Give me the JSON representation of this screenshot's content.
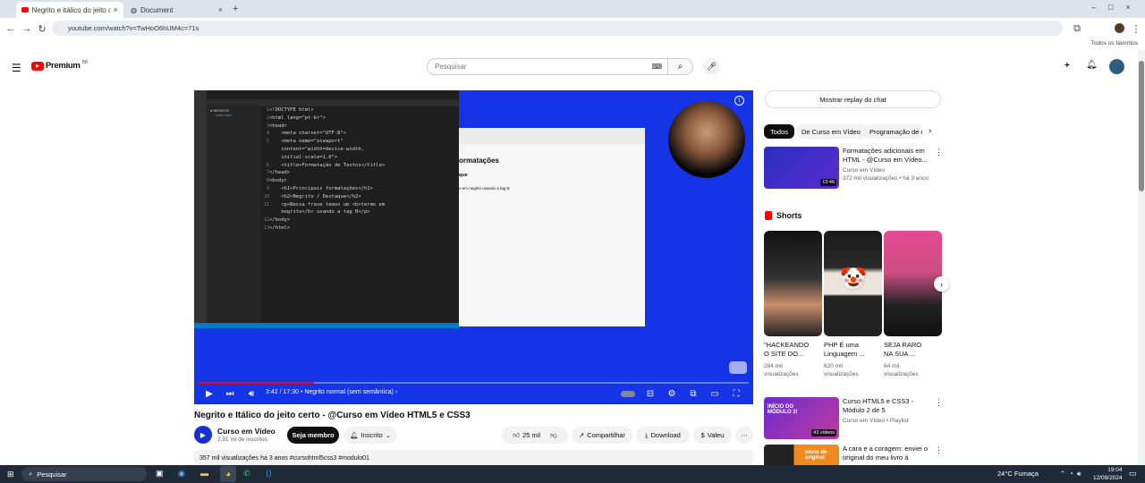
{
  "browser": {
    "tabs": [
      {
        "title": "Negrito e itálico do jeito certo",
        "active": true,
        "icon": "youtube-icon"
      },
      {
        "title": "Document",
        "active": false,
        "icon": "globe-icon"
      }
    ],
    "new_tab": "+",
    "url": "youtube.com/watch?v=TwHoO6hUM4c=71s",
    "bookmarks_label": "Todos os favoritos"
  },
  "youtube": {
    "logo_text": "Premium",
    "logo_region": "BR",
    "search_placeholder": "Pesquisar",
    "create_label": "+",
    "video": {
      "title": "Negrito e Itálico do jeito certo - @Curso em Vídeo HTML5 e CSS3",
      "time": "3:42 / 17:30",
      "chapter": "• Negrito normal (sem semântica) ›",
      "progress": 0.21,
      "views_line": "357 mil visualizações  há 3 anos  #cursohtml5css3 #modulo01"
    },
    "channel": {
      "name": "Curso em Vídeo",
      "subs": "2,91 mi de inscritos",
      "join": "Seja membro",
      "subscribed": "Inscrito"
    },
    "actions": {
      "likes": "25 mil",
      "share": "Compartilhar",
      "download": "Download",
      "thanks": "Valeu",
      "more": "⋯"
    },
    "sidebar": {
      "chat_replay": "Mostrar replay do chat",
      "chips": [
        "Todos",
        "De Curso em Vídeo",
        "Programação de c"
      ],
      "rec1": {
        "title": "Formatações adicionais em HTML - @Curso em Vídeo...",
        "channel": "Curso em Vídeo",
        "meta": "372 mil visualizações • há 3 anos",
        "duration": "13:46"
      },
      "shorts_label": "Shorts",
      "shorts": [
        {
          "title": "\"HACKEANDO O SITE DO...",
          "meta": "284 mil visualizações"
        },
        {
          "title": "PHP É uma Linguagem ...",
          "meta": "620 mil visualizações"
        },
        {
          "title": "SEJA RARO NA SUA ...",
          "meta": "64 mil visualizações"
        }
      ],
      "rec2": {
        "title": "Curso HTML5 e CSS3 - Módulo 2 de 5",
        "channel": "Curso em Vídeo • Playlist",
        "badge": "43 vídeos",
        "thumb_text": "INÍCIO DO MÓDULO 2!"
      },
      "rec3": {
        "title": "A cara e a coragem: enviei o original do meu livro à Editora...",
        "thumb_text": "envio de original"
      }
    }
  },
  "code_lines": [
    "<!DOCTYPE html>",
    "<html lang=\"pt-br\">",
    "<head>",
    "    <meta charset=\"UTF-8\">",
    "    <meta name=\"viewport\"",
    "    content=\"width=device-width,",
    "    initial-scale=1.0\">",
    "    <title>Formatação de Textos</title>",
    "</head>",
    "<body>",
    "    <h1>Principais formatações</h1>",
    "    <h2>Negrito / Destaque</h2>",
    "    <p>Nessa frase temos um <b>termo em",
    "    negrito</b> usando a tag B</p>",
    "</body>",
    "</html>"
  ],
  "preview": {
    "heading": "ormatações",
    "subheading": "que",
    "paragraph": "o em negrito usando a tag B"
  },
  "taskbar": {
    "search": "Pesquisar",
    "weather": "24°C  Fumaça",
    "time": "19:04",
    "date": "12/09/2024"
  }
}
